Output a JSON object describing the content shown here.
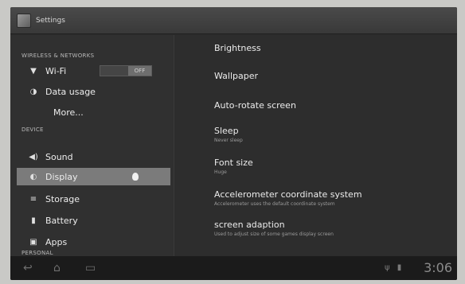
{
  "action_bar": {
    "title": "Settings",
    "app_icon": "settings-app-icon"
  },
  "sidebar": {
    "sections": [
      {
        "id": "wireless",
        "label": "WIRELESS & NETWORKS"
      },
      {
        "id": "device",
        "label": "DEVICE"
      },
      {
        "id": "personal",
        "label": "PERSONAL"
      }
    ],
    "items": [
      {
        "id": "wifi",
        "label": "Wi-Fi",
        "icon": "wifi-icon"
      },
      {
        "id": "data-usage",
        "label": "Data usage",
        "icon": "data-usage-icon"
      },
      {
        "id": "more",
        "label": "More...",
        "icon": ""
      },
      {
        "id": "sound",
        "label": "Sound",
        "icon": "speaker-icon"
      },
      {
        "id": "display",
        "label": "Display",
        "icon": "display-icon",
        "selected": true
      },
      {
        "id": "storage",
        "label": "Storage",
        "icon": "storage-icon"
      },
      {
        "id": "battery",
        "label": "Battery",
        "icon": "battery-icon"
      },
      {
        "id": "apps",
        "label": "Apps",
        "icon": "apps-icon"
      }
    ],
    "wifi_switch": {
      "state_label": "OFF"
    }
  },
  "content": {
    "settings": [
      {
        "id": "brightness",
        "title": "Brightness",
        "summary": ""
      },
      {
        "id": "wallpaper",
        "title": "Wallpaper",
        "summary": ""
      },
      {
        "id": "auto-rotate",
        "title": "Auto-rotate screen",
        "summary": ""
      },
      {
        "id": "sleep",
        "title": "Sleep",
        "summary": "Never sleep"
      },
      {
        "id": "font-size",
        "title": "Font size",
        "summary": "Huge"
      },
      {
        "id": "accelerometer",
        "title": "Accelerometer coordinate system",
        "summary": "Accelerometer uses the default coordinate system"
      },
      {
        "id": "screen-adaption",
        "title": "screen adaption",
        "summary": "Used to adjust size of some games display screen"
      }
    ]
  },
  "status_bar": {
    "time": "3:06"
  },
  "colors": {
    "selected_bg": "#7b7b7b",
    "screen_bg": "#2b2b2b"
  }
}
